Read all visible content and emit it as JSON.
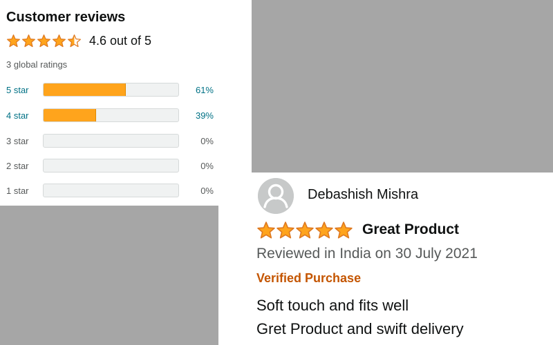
{
  "ratings": {
    "title": "Customer reviews",
    "average_stars": 4.6,
    "average_text": "4.6 out of 5",
    "global_ratings": "3 global ratings",
    "histogram": [
      {
        "label": "5 star",
        "percent_text": "61%",
        "fraction": 0.61,
        "link": true
      },
      {
        "label": "4 star",
        "percent_text": "39%",
        "fraction": 0.39,
        "link": true
      },
      {
        "label": "3 star",
        "percent_text": "0%",
        "fraction": 0,
        "link": false
      },
      {
        "label": "2 star",
        "percent_text": "0%",
        "fraction": 0,
        "link": false
      },
      {
        "label": "1 star",
        "percent_text": "0%",
        "fraction": 0,
        "link": false
      }
    ]
  },
  "review": {
    "reviewer_name": "Debashish Mishra",
    "stars": 5,
    "title": "Great Product",
    "meta": "Reviewed in India on 30 July 2021",
    "verified": "Verified Purchase",
    "body": [
      "Soft touch and fits well",
      "Gret Product and swift delivery"
    ]
  },
  "colors": {
    "star": "#ffa41c",
    "star_stroke": "#de7921",
    "bar_fill": "#ffa41c",
    "link": "#007185",
    "verified": "#c45500"
  },
  "icons": {
    "star": "star-icon",
    "avatar": "default-avatar-icon"
  }
}
